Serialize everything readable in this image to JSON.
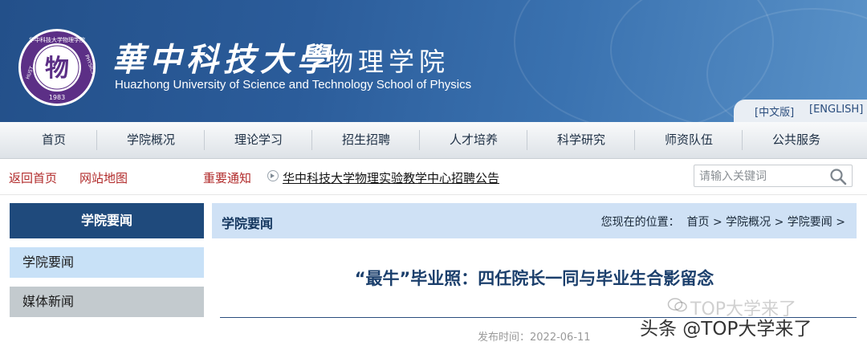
{
  "header": {
    "logo_text_top": "华中科技大学物理学院",
    "logo_text_left": "HUST",
    "logo_text_right": "PHYSICS",
    "logo_year": "1983",
    "logo_char": "物",
    "university_cn": "華中科技大學",
    "school_cn": "物理学院",
    "university_en": "Huazhong University of  Science and Technology School of Physics",
    "lang_cn": "[中文版]",
    "lang_en": "[ENGLISH]",
    "colors": {
      "banner": "#2b5c9a",
      "logo_purple": "#5c2f86"
    }
  },
  "nav": {
    "items": [
      "首页",
      "学院概况",
      "理论学习",
      "招生招聘",
      "人才培养",
      "科学研究",
      "师资队伍",
      "公共服务"
    ]
  },
  "quickbar": {
    "home": "返回首页",
    "sitemap": "网站地图",
    "notice_label": "重要通知",
    "notice_text": "华中科技大学物理实验教学中心招聘公告",
    "search_placeholder": "请输入关键词",
    "search_icon": "search-icon"
  },
  "sidebar": {
    "title": "学院要闻",
    "items": [
      {
        "label": "学院要闻",
        "active": true
      },
      {
        "label": "媒体新闻",
        "active": false
      }
    ]
  },
  "main": {
    "section_title": "学院要闻",
    "location_label": "您现在的位置：",
    "breadcrumb": "首页 > 学院概况 > 学院要闻 >",
    "article_title": "“最牛”毕业照：四任院长一同与毕业生合影留念",
    "pubdate": "发布时间：2022-06-11"
  },
  "watermark": {
    "faint": "TOP大学来了",
    "main": "头条 @TOP大学来了"
  }
}
